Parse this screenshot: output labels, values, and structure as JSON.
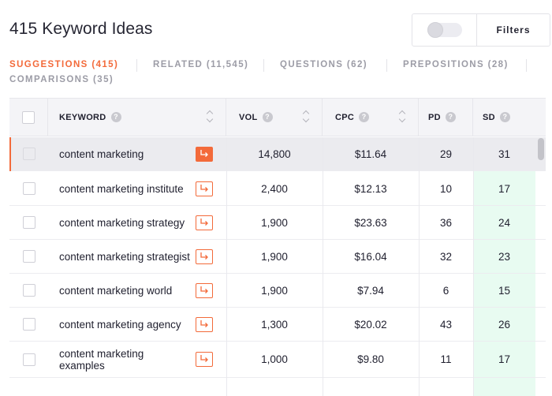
{
  "page_title": "415 Keyword Ideas",
  "filters_label": "Filters",
  "tabs": [
    {
      "label": "SUGGESTIONS (415)",
      "active": true
    },
    {
      "label": "RELATED (11,545)",
      "active": false
    },
    {
      "label": "QUESTIONS (62)",
      "active": false
    },
    {
      "label": "PREPOSITIONS (28)",
      "active": false
    },
    {
      "label": "COMPARISONS (35)",
      "active": false
    }
  ],
  "table": {
    "headers": {
      "keyword": "KEYWORD",
      "vol": "VOL",
      "cpc": "CPC",
      "pd": "PD",
      "sd": "SD"
    },
    "rows": [
      {
        "keyword": "content marketing",
        "vol": "14,800",
        "cpc": "$11.64",
        "pd": "29",
        "sd": "31"
      },
      {
        "keyword": "content marketing institute",
        "vol": "2,400",
        "cpc": "$12.13",
        "pd": "10",
        "sd": "17"
      },
      {
        "keyword": "content marketing strategy",
        "vol": "1,900",
        "cpc": "$23.63",
        "pd": "36",
        "sd": "24"
      },
      {
        "keyword": "content marketing strategist",
        "vol": "1,900",
        "cpc": "$16.04",
        "pd": "32",
        "sd": "23"
      },
      {
        "keyword": "content marketing world",
        "vol": "1,900",
        "cpc": "$7.94",
        "pd": "6",
        "sd": "15"
      },
      {
        "keyword": "content marketing agency",
        "vol": "1,300",
        "cpc": "$20.02",
        "pd": "43",
        "sd": "26"
      },
      {
        "keyword": "content marketing examples",
        "vol": "1,000",
        "cpc": "$9.80",
        "pd": "11",
        "sd": "17"
      }
    ]
  },
  "colors": {
    "accent": "#f36a3a",
    "sd_highlight": "#7ee6b0",
    "sd_background": "#e8fbf1"
  },
  "icons": {
    "row_action": "arrow-return-right-icon",
    "help": "question-circle-icon",
    "sort": "sort-chevrons-icon"
  }
}
